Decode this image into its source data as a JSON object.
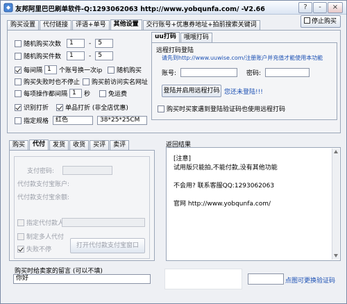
{
  "window": {
    "title": "友邦阿里巴巴刷单软件-Q:1293062063   http://www.yobqunfa.com/   -V2.66",
    "title_buttons": [
      "?",
      "-",
      "×"
    ],
    "stop_button": "停止购买"
  },
  "main_tabs": [
    "购买设置",
    "代付链接",
    "评语+单号",
    "其他设置",
    "交行账号+优惠券地址+拍前搜索关键词"
  ],
  "settings": {
    "random_buy_count": {
      "label": "随机购买次数",
      "min": "1",
      "sep": "-",
      "max": "5"
    },
    "random_item_count": {
      "label": "随机购买件数",
      "min": "1",
      "sep": "-",
      "max": "5"
    },
    "interval": {
      "label": "每间隔",
      "value": "1",
      "suffix": "个账号换一次ip"
    },
    "random_buy": "随机购买",
    "fail_no_stop": "购买失败时也不停止",
    "visit_real_url": "购买前访问实名网址",
    "op_interval": {
      "label": "每项操作都间隔",
      "value": "1",
      "suffix": "秒"
    },
    "free_shipping": "免运费",
    "recognize_captcha": "识别打折",
    "single_print": "单品打折 (非全店优惠)",
    "spec": {
      "label": "指定规格",
      "color": "红色",
      "size": "38*25*25CM"
    }
  },
  "captcha_tabs": [
    "uu打码",
    "哦哦打码"
  ],
  "captcha": {
    "group_title": "远程打码登陆",
    "notice": "请先到http://www.uuwise.com/注册账户并充值才能使用本功能",
    "account_label": "账号:",
    "password_label": "密码:",
    "login_button": "登陆并启用远程打码",
    "not_logged": "您还未登陆!!!",
    "auto_captcha": "购买时买家遇到登陆验证码也使用远程打码"
  },
  "pay_tabs": [
    "购买",
    "代付",
    "发货",
    "收货",
    "买评",
    "卖评"
  ],
  "pay": {
    "pay_password_label": "支付密码:",
    "pay_account_label": "代付款支付宝账户:",
    "pay_password2_label": "代付款支付宝余额:",
    "assign_payer": "指定代付款人",
    "multi_payer": "制定多人代付",
    "fail_no_stop": "失败不停",
    "open_window_button": "打开代付款支付宝窗口"
  },
  "result": {
    "title": "返回结果",
    "lines": [
      "[注意]",
      "试用版只能拍,不能付款,没有其他功能",
      "",
      "不会用? 联系客服QQ:1293062063",
      "",
      "官网 http://www.yobqunfa.com/"
    ]
  },
  "footer": {
    "message_label": "购买时给卖家的留言 (可以不填)",
    "message_value": "你好",
    "refresh_captcha": "点图可更换验证码"
  },
  "colors": {
    "link_blue": "#1a4fb3",
    "title_gradient_top": "#fafcff",
    "title_gradient_bottom": "#dbe5f3"
  }
}
